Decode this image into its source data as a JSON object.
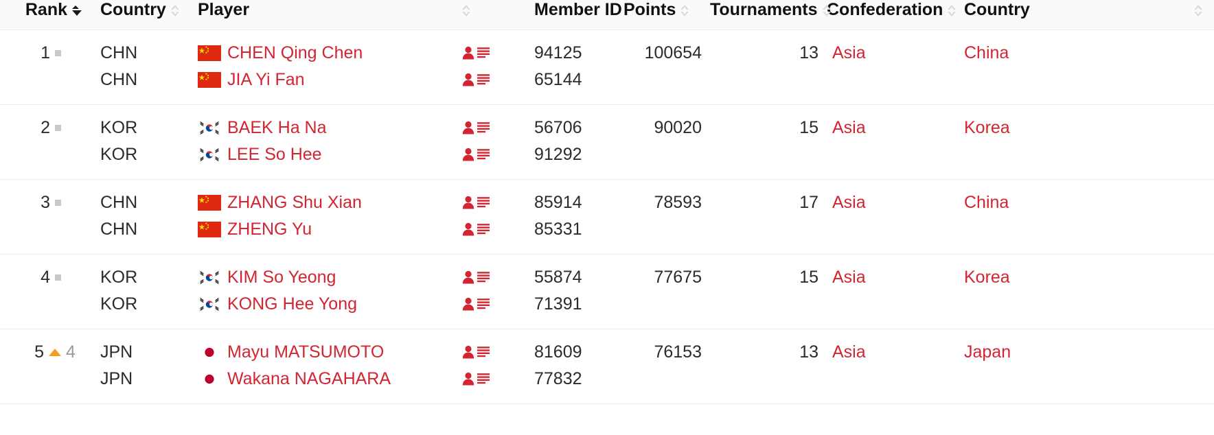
{
  "table": {
    "columns": [
      {
        "key": "rank",
        "label": "Rank",
        "sort": "active-desc",
        "align": "right"
      },
      {
        "key": "country_code",
        "label": "Country",
        "sort": "inactive",
        "align": "left"
      },
      {
        "key": "player",
        "label": "Player",
        "sort": "none",
        "align": "left"
      },
      {
        "key": "profile",
        "label": "",
        "sort": "inactive",
        "align": "left"
      },
      {
        "key": "member_id",
        "label": "Member ID",
        "sort": "none",
        "align": "left"
      },
      {
        "key": "points",
        "label": "Points",
        "sort": "inactive",
        "align": "left"
      },
      {
        "key": "tournaments",
        "label": "Tournaments",
        "sort": "inactive",
        "align": "left"
      },
      {
        "key": "confederation",
        "label": "Confederation",
        "sort": "inactive",
        "align": "left"
      },
      {
        "key": "country",
        "label": "Country",
        "sort": "inactive",
        "align": "left"
      }
    ],
    "rows": [
      {
        "rank": "1",
        "movement": {
          "type": "none",
          "delta": ""
        },
        "players": [
          {
            "country_code": "CHN",
            "flag": "china-flag",
            "name": "CHEN Qing Chen",
            "member_id": "94125",
            "profile_icon": "player-profile-icon"
          },
          {
            "country_code": "CHN",
            "flag": "china-flag",
            "name": "JIA Yi Fan",
            "member_id": "65144",
            "profile_icon": "player-profile-icon"
          }
        ],
        "points": "100654",
        "tournaments": "13",
        "confederation": "Asia",
        "country": "China"
      },
      {
        "rank": "2",
        "movement": {
          "type": "none",
          "delta": ""
        },
        "players": [
          {
            "country_code": "KOR",
            "flag": "korea-flag",
            "name": "BAEK Ha Na",
            "member_id": "56706",
            "profile_icon": "player-profile-icon"
          },
          {
            "country_code": "KOR",
            "flag": "korea-flag",
            "name": "LEE So Hee",
            "member_id": "91292",
            "profile_icon": "player-profile-icon"
          }
        ],
        "points": "90020",
        "tournaments": "15",
        "confederation": "Asia",
        "country": "Korea"
      },
      {
        "rank": "3",
        "movement": {
          "type": "none",
          "delta": ""
        },
        "players": [
          {
            "country_code": "CHN",
            "flag": "china-flag",
            "name": "ZHANG Shu Xian",
            "member_id": "85914",
            "profile_icon": "player-profile-icon"
          },
          {
            "country_code": "CHN",
            "flag": "china-flag",
            "name": "ZHENG Yu",
            "member_id": "85331",
            "profile_icon": "player-profile-icon"
          }
        ],
        "points": "78593",
        "tournaments": "17",
        "confederation": "Asia",
        "country": "China"
      },
      {
        "rank": "4",
        "movement": {
          "type": "none",
          "delta": ""
        },
        "players": [
          {
            "country_code": "KOR",
            "flag": "korea-flag",
            "name": "KIM So Yeong",
            "member_id": "55874",
            "profile_icon": "player-profile-icon"
          },
          {
            "country_code": "KOR",
            "flag": "korea-flag",
            "name": "KONG Hee Yong",
            "member_id": "71391",
            "profile_icon": "player-profile-icon"
          }
        ],
        "points": "77675",
        "tournaments": "15",
        "confederation": "Asia",
        "country": "Korea"
      },
      {
        "rank": "5",
        "movement": {
          "type": "up",
          "delta": "4"
        },
        "players": [
          {
            "country_code": "JPN",
            "flag": "japan-flag",
            "name": "Mayu MATSUMOTO",
            "member_id": "81609",
            "profile_icon": "player-profile-icon"
          },
          {
            "country_code": "JPN",
            "flag": "japan-flag",
            "name": "Wakana NAGAHARA",
            "member_id": "77832",
            "profile_icon": "player-profile-icon"
          }
        ],
        "points": "76153",
        "tournaments": "13",
        "confederation": "Asia",
        "country": "Japan"
      }
    ]
  },
  "colors": {
    "link_red": "#d32531",
    "flag_red": "#de2910",
    "movement_up": "#f0a020",
    "movement_none": "#c9c9c9",
    "text": "#2b2b2b",
    "header_text": "#111111",
    "divider": "#ebebeb"
  }
}
